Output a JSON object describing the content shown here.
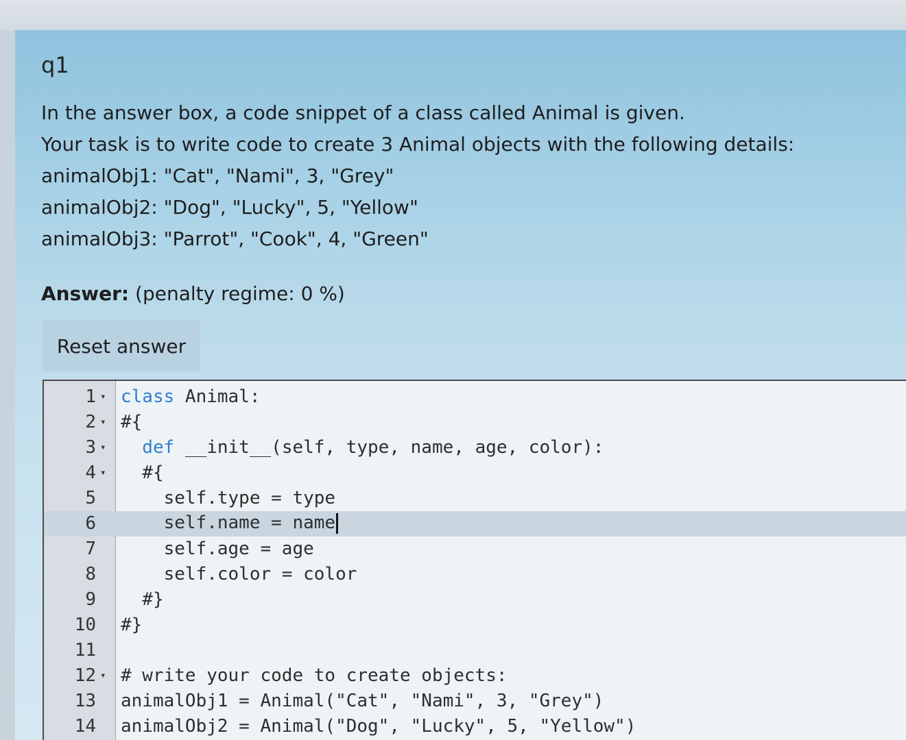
{
  "question": {
    "number": "q1",
    "lines": [
      "In the answer box, a code snippet of a class called Animal is given.",
      "Your task is to write code to create 3 Animal objects with the following details:",
      "animalObj1: \"Cat\", \"Nami\", 3, \"Grey\"",
      "animalObj2: \"Dog\", \"Lucky\", 5, \"Yellow\"",
      "animalObj3: \"Parrot\", \"Cook\", 4, \"Green\""
    ]
  },
  "answer": {
    "label": "Answer:",
    "penalty": "(penalty regime: 0 %)",
    "reset_label": "Reset answer"
  },
  "editor": {
    "active_line": 6,
    "lines": [
      {
        "n": "1",
        "fold": "▾",
        "kw": "class",
        "rest": " Animal:"
      },
      {
        "n": "2",
        "fold": "▾",
        "kw": "",
        "rest": "#{"
      },
      {
        "n": "3",
        "fold": "▾",
        "kw": "  def",
        "rest": " __init__(self, type, name, age, color):"
      },
      {
        "n": "4",
        "fold": "▾",
        "kw": "",
        "rest": "  #{"
      },
      {
        "n": "5",
        "fold": "",
        "kw": "",
        "rest": "    self.type = type"
      },
      {
        "n": "6",
        "fold": "",
        "kw": "",
        "rest": "    self.name = name"
      },
      {
        "n": "7",
        "fold": "",
        "kw": "",
        "rest": "    self.age = age"
      },
      {
        "n": "8",
        "fold": "",
        "kw": "",
        "rest": "    self.color = color"
      },
      {
        "n": "9",
        "fold": "",
        "kw": "",
        "rest": "  #}"
      },
      {
        "n": "10",
        "fold": "",
        "kw": "",
        "rest": "#}"
      },
      {
        "n": "11",
        "fold": "",
        "kw": "",
        "rest": ""
      },
      {
        "n": "12",
        "fold": "▾",
        "kw": "",
        "rest": "# write your code to create objects:"
      },
      {
        "n": "13",
        "fold": "",
        "kw": "",
        "rest": "animalObj1 = Animal(\"Cat\", \"Nami\", 3, \"Grey\")"
      },
      {
        "n": "14",
        "fold": "",
        "kw": "",
        "rest": "animalObj2 = Animal(\"Dog\", \"Lucky\", 5, \"Yellow\")"
      }
    ]
  }
}
